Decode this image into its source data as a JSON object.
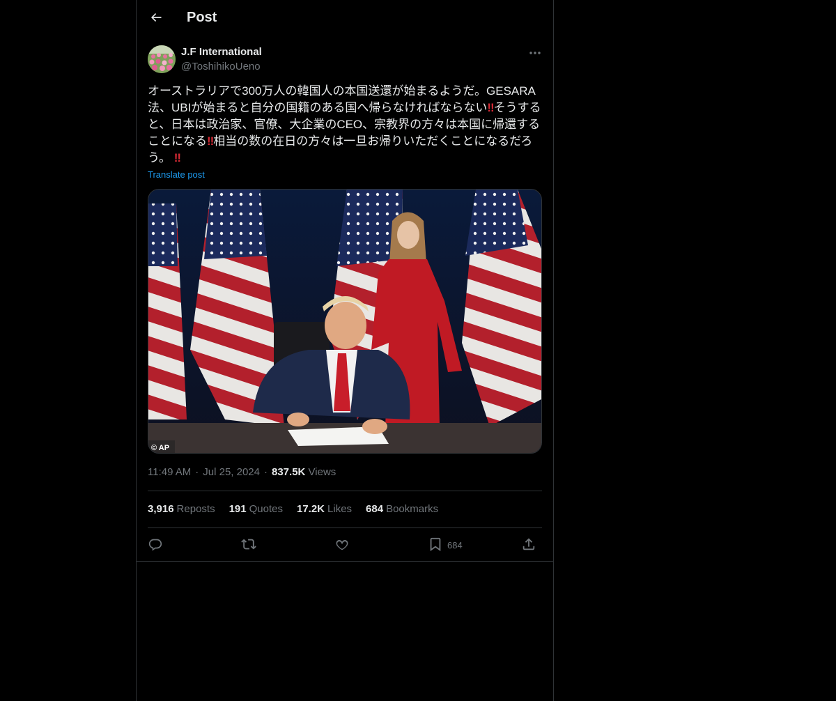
{
  "header": {
    "title": "Post",
    "back_icon": "arrow-left-icon"
  },
  "author": {
    "name": "J.F International",
    "handle": "@ToshihikoUeno",
    "avatar": "tulip-field-avatar"
  },
  "post": {
    "text_1": "オーストラリアで300万人の韓国人の本国送還が始まるようだ。GESARA法、UBIが始まると自分の国籍のある国へ帰らなければならない",
    "bang": "‼",
    "text_2": "そうすると、日本は政治家、官僚、大企業のCEO、宗教界の方々は本国に帰還することになる",
    "text_3": "相当の数の在日の方々は一旦お帰りいただくことになるだろう。",
    "translate_label": "Translate post",
    "image_credit": "© AP"
  },
  "meta": {
    "time": "11:49 AM",
    "dot": "·",
    "date": "Jul 25, 2024",
    "views_count": "837.5K",
    "views_label": "Views"
  },
  "stats": {
    "reposts_count": "3,916",
    "reposts_label": "Reposts",
    "quotes_count": "191",
    "quotes_label": "Quotes",
    "likes_count": "17.2K",
    "likes_label": "Likes",
    "bookmarks_count": "684",
    "bookmarks_label": "Bookmarks"
  },
  "actions": {
    "bookmark_count": "684"
  },
  "colors": {
    "background": "#000000",
    "border": "#2f3336",
    "accent": "#1d9bf0",
    "muted": "#71767b",
    "text": "#e7e9ea",
    "bang": "#d62a35"
  }
}
